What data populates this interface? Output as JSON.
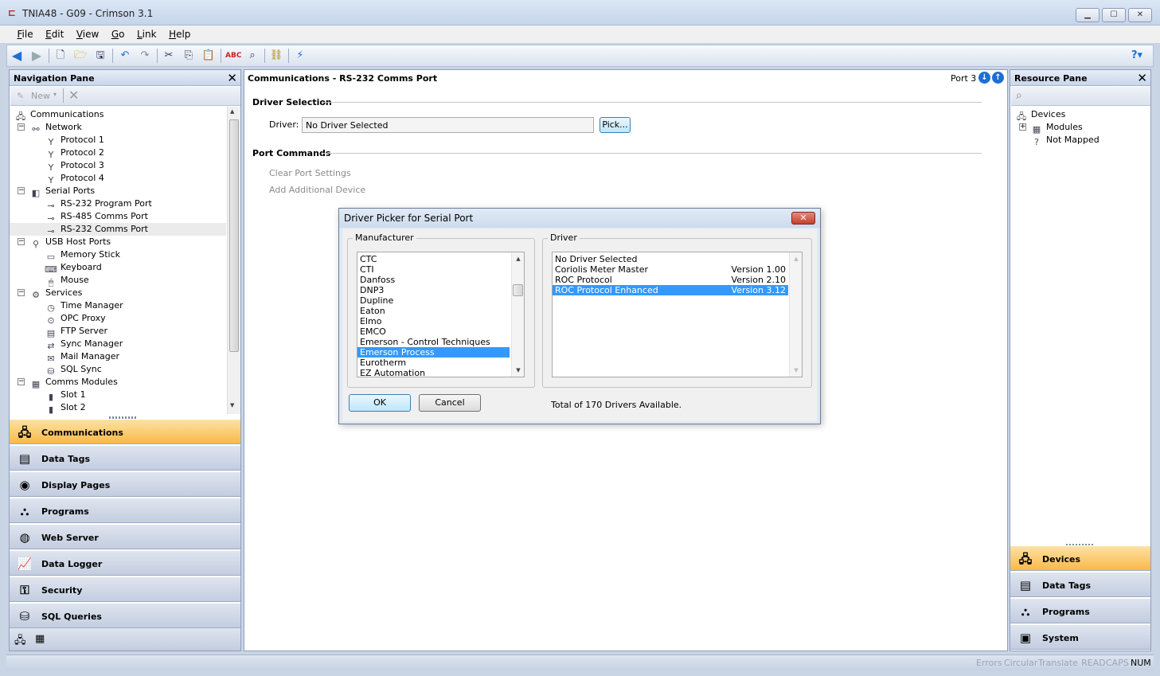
{
  "window": {
    "title": "TNIA48 - G09 - Crimson 3.1",
    "app_icon": "crimson-app-icon",
    "minimize": "▁",
    "maximize": "☐",
    "close": "✕"
  },
  "menu": [
    "File",
    "Edit",
    "View",
    "Go",
    "Link",
    "Help"
  ],
  "toolbar": {
    "icons": [
      "back-icon",
      "forward-icon",
      "new-icon",
      "open-icon",
      "save-icon",
      "undo-icon",
      "redo-icon",
      "cut-icon",
      "copy-icon",
      "paste-icon",
      "spell-check-icon",
      "find-icon",
      "link-icon",
      "send-icon",
      "help-icon"
    ]
  },
  "nav_pane": {
    "title": "Navigation Pane",
    "new_label": "New",
    "tree": [
      {
        "label": "Communications",
        "level": 0,
        "icon": "🖧"
      },
      {
        "label": "Network",
        "level": 1,
        "icon": "⚯",
        "expander": "−"
      },
      {
        "label": "Protocol 1",
        "level": 2,
        "icon": "Y"
      },
      {
        "label": "Protocol 2",
        "level": 2,
        "icon": "Y"
      },
      {
        "label": "Protocol 3",
        "level": 2,
        "icon": "Y"
      },
      {
        "label": "Protocol 4",
        "level": 2,
        "icon": "Y"
      },
      {
        "label": "Serial Ports",
        "level": 1,
        "icon": "◧",
        "expander": "−"
      },
      {
        "label": "RS-232 Program Port",
        "level": 2,
        "icon": "⊸"
      },
      {
        "label": "RS-485 Comms Port",
        "level": 2,
        "icon": "⊸"
      },
      {
        "label": "RS-232 Comms Port",
        "level": 2,
        "icon": "⊸",
        "selected": true
      },
      {
        "label": "USB Host Ports",
        "level": 1,
        "icon": "⚲",
        "expander": "−"
      },
      {
        "label": "Memory Stick",
        "level": 2,
        "icon": "▭"
      },
      {
        "label": "Keyboard",
        "level": 2,
        "icon": "⌨"
      },
      {
        "label": "Mouse",
        "level": 2,
        "icon": "🖱"
      },
      {
        "label": "Services",
        "level": 1,
        "icon": "⚙",
        "expander": "−"
      },
      {
        "label": "Time Manager",
        "level": 2,
        "icon": "◷"
      },
      {
        "label": "OPC Proxy",
        "level": 2,
        "icon": "⊙"
      },
      {
        "label": "FTP Server",
        "level": 2,
        "icon": "▤"
      },
      {
        "label": "Sync Manager",
        "level": 2,
        "icon": "⇄"
      },
      {
        "label": "Mail Manager",
        "level": 2,
        "icon": "✉"
      },
      {
        "label": "SQL Sync",
        "level": 2,
        "icon": "⛁"
      },
      {
        "label": "Comms Modules",
        "level": 1,
        "icon": "▦",
        "expander": "−"
      },
      {
        "label": "Slot 1",
        "level": 2,
        "icon": "▮"
      },
      {
        "label": "Slot 2",
        "level": 2,
        "icon": "▮"
      }
    ],
    "categories": [
      {
        "label": "Communications",
        "icon": "🖧",
        "active": true
      },
      {
        "label": "Data Tags",
        "icon": "▤"
      },
      {
        "label": "Display Pages",
        "icon": "◉"
      },
      {
        "label": "Programs",
        "icon": "⛬"
      },
      {
        "label": "Web Server",
        "icon": "◍"
      },
      {
        "label": "Data Logger",
        "icon": "📈"
      },
      {
        "label": "Security",
        "icon": "⚿"
      },
      {
        "label": "SQL Queries",
        "icon": "⛁"
      }
    ]
  },
  "center": {
    "title": "Communications - RS-232 Comms Port",
    "port_label": "Port 3",
    "driver_section": "Driver Selection",
    "driver_label": "Driver:",
    "driver_value": "No Driver Selected",
    "pick_label": "Pick...",
    "commands_section": "Port Commands",
    "commands": [
      "Clear Port Settings",
      "Add Additional Device"
    ]
  },
  "dialog": {
    "title": "Driver Picker for Serial Port",
    "manufacturer_label": "Manufacturer",
    "manufacturers": [
      "CTC",
      "CTI",
      "Danfoss",
      "DNP3",
      "Dupline",
      "Eaton",
      "Elmo",
      "EMCO",
      "Emerson - Control Techniques",
      "Emerson Process",
      "Eurotherm",
      "EZ Automation"
    ],
    "selected_manufacturer": "Emerson Process",
    "driver_label": "Driver",
    "drivers": [
      {
        "name": "No Driver Selected",
        "version": ""
      },
      {
        "name": "Coriolis Meter Master",
        "version": "Version 1.00"
      },
      {
        "name": "ROC Protocol",
        "version": "Version 2.10"
      },
      {
        "name": "ROC Protocol Enhanced",
        "version": "Version 3.12",
        "selected": true
      }
    ],
    "ok_label": "OK",
    "cancel_label": "Cancel",
    "total_text": "Total of 170 Drivers Available."
  },
  "resource_pane": {
    "title": "Resource Pane",
    "tree": [
      {
        "label": "Devices",
        "level": 0,
        "icon": "🖧"
      },
      {
        "label": "Modules",
        "level": 1,
        "icon": "▦",
        "expander": "+"
      },
      {
        "label": "Not Mapped",
        "level": 1,
        "icon": "?"
      }
    ],
    "categories": [
      {
        "label": "Devices",
        "icon": "🖧",
        "active": true
      },
      {
        "label": "Data Tags",
        "icon": "▤"
      },
      {
        "label": "Programs",
        "icon": "⛬"
      },
      {
        "label": "System",
        "icon": "▣"
      }
    ]
  },
  "status": {
    "items": [
      {
        "label": "Errors",
        "on": false
      },
      {
        "label": "Circular",
        "on": false
      },
      {
        "label": "Translate",
        "on": false
      },
      {
        "label": "READ",
        "on": false
      },
      {
        "label": "CAPS",
        "on": false
      },
      {
        "label": "NUM",
        "on": true
      }
    ]
  }
}
